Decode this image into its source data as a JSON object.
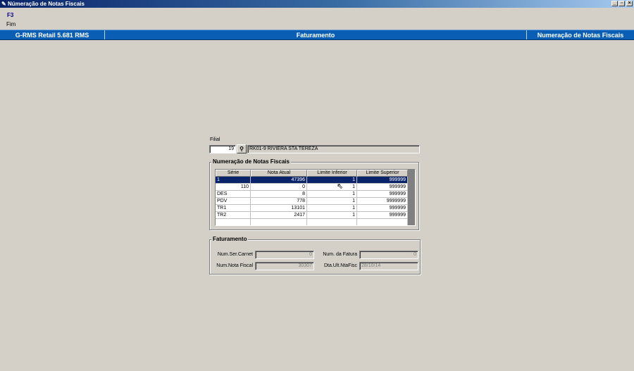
{
  "window": {
    "title": "Númeração de Notas Fiscais",
    "buttons": [
      "_",
      "▫",
      "×"
    ]
  },
  "toolbar": {
    "key": "F3",
    "label": "Fim"
  },
  "header": {
    "app": "G-RMS Retail 5.681 RMS",
    "module": "Faturamento",
    "screen": "Numeração de Notas Fiscais"
  },
  "filial": {
    "label": "Filial",
    "code": "19",
    "name": "RK01-9 RIVIERA STA TEREZA",
    "search_icon": "binoculars-icon"
  },
  "numeracao": {
    "title": "Numeração de Notas Fiscais",
    "columns": [
      "Série",
      "Nota Atual",
      "Limite Inferior",
      "Limite Superior"
    ],
    "rows": [
      [
        "1",
        "47396",
        "1",
        "999999"
      ],
      [
        "110",
        "0",
        "1",
        "999999"
      ],
      [
        "DES",
        "8",
        "1",
        "999999"
      ],
      [
        "PDV",
        "778",
        "1",
        "9999999"
      ],
      [
        "TR1",
        "13101",
        "1",
        "999999"
      ],
      [
        "TR2",
        "2417",
        "1",
        "999999"
      ]
    ]
  },
  "faturamento": {
    "title": "Faturamento",
    "num_ser_carnet_label": "Num.Ser.Carnet",
    "num_ser_carnet": "0",
    "num_nota_fiscal_label": "Num.Nota Fiscal",
    "num_nota_fiscal": "30307",
    "num_fatura_label": "Num. da Fatura",
    "num_fatura": "0",
    "dta_ult_label": "Dta.Ult.NtaFisc",
    "dta_ult": "28/10/14"
  },
  "colors": {
    "titlebar": "#0a246a",
    "band": "#0a5fb4",
    "selection": "#0a246a",
    "face": "#d4d0c8"
  }
}
